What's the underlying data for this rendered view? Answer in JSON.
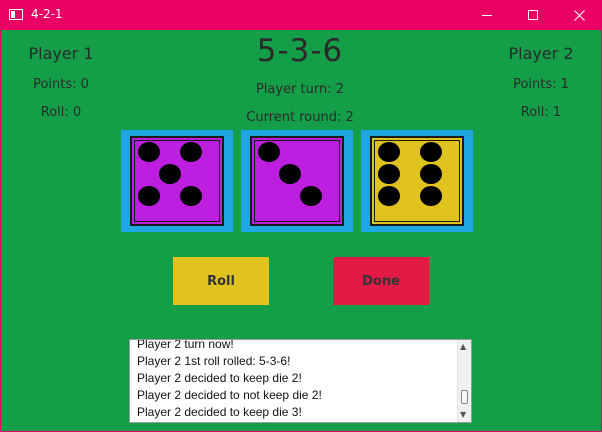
{
  "window": {
    "title": "4-2-1",
    "titlebar_color": "#ea0064",
    "buttons": [
      "minimize",
      "maximize",
      "close"
    ]
  },
  "colors": {
    "background": "#149e48",
    "die_frame": "#1ea7e2",
    "die_purple": "#bd1ee0",
    "die_yellow": "#e0c31e",
    "roll_button": "#e0c31e",
    "done_button": "#e31a46"
  },
  "player1": {
    "name": "Player 1",
    "points": "Points: 0",
    "roll": "Roll: 0"
  },
  "player2": {
    "name": "Player 2",
    "points": "Points: 1",
    "roll": "Roll: 1"
  },
  "center": {
    "result": "5-3-6",
    "turn": "Player turn: 2",
    "round": "Current round: 2"
  },
  "dice": [
    {
      "value": 5,
      "color": "#bd1ee0",
      "kept": false
    },
    {
      "value": 3,
      "color": "#bd1ee0",
      "kept": true
    },
    {
      "value": 6,
      "color": "#e0c31e",
      "kept": false
    }
  ],
  "buttons": {
    "roll": "Roll",
    "done": "Done"
  },
  "log": [
    "Player 2 turn now!",
    "Player 2 1st roll rolled: 5-3-6!",
    "Player 2 decided to keep die 2!",
    "Player 2 decided to not keep die 2!",
    "Player 2 decided to keep die 3!"
  ]
}
